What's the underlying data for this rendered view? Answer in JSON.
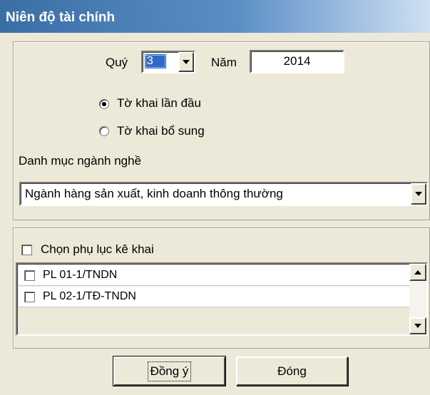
{
  "window": {
    "title": "Niên độ tài chính"
  },
  "period": {
    "quarter_label": "Quý",
    "quarter_value": "3",
    "year_label": "Năm",
    "year_value": "2014"
  },
  "declaration_type": {
    "options": [
      {
        "label": "Tờ khai lần đầu",
        "selected": true
      },
      {
        "label": "Tờ khai bổ sung",
        "selected": false
      }
    ]
  },
  "industry": {
    "label": "Danh mục ngành nghề",
    "selected": "Ngành hàng sản xuất, kinh doanh thông thường"
  },
  "appendix": {
    "select_all_label": "Chọn phụ lục kê khai",
    "items": [
      {
        "label": "PL 01-1/TNDN",
        "checked": false
      },
      {
        "label": "PL 02-1/TĐ-TNDN",
        "checked": false
      }
    ]
  },
  "buttons": {
    "ok": "Đồng ý",
    "close": "Đóng"
  },
  "colors": {
    "title_bar": "#3a6ea5",
    "selection": "#316ac5",
    "window_bg": "#ece9d8"
  }
}
